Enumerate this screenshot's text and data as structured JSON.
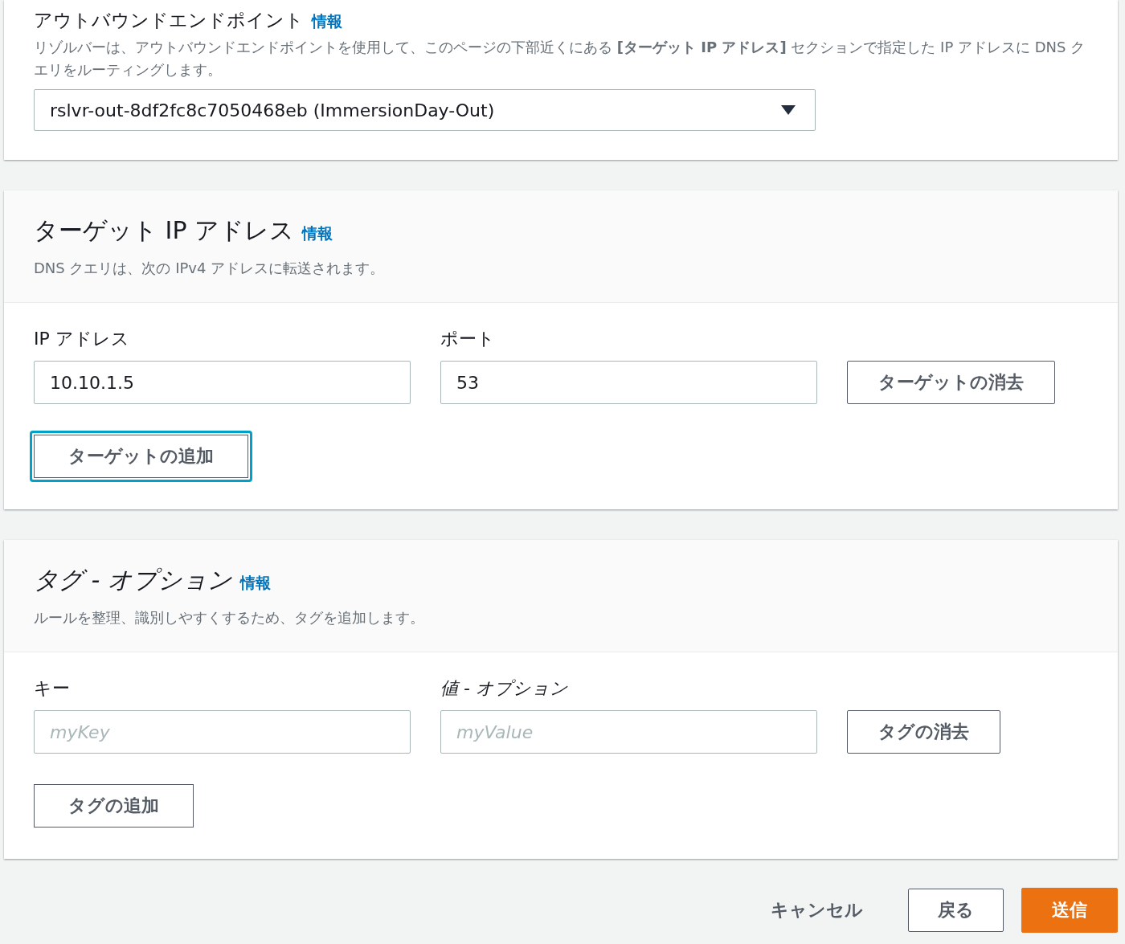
{
  "outbound_endpoint": {
    "title": "アウトバウンドエンドポイント",
    "info_link": "情報",
    "description": "リゾルバーは、アウトバウンドエンドポイントを使用して、このページの下部近くにある **[ターゲット IP アドレス]** セクションで指定した IP アドレスに DNS クエリをルーティングします。",
    "select_value": "rslvr-out-8df2fc8c7050468eb (ImmersionDay-Out)"
  },
  "target_ips": {
    "title": "ターゲット IP アドレス",
    "info_link": "情報",
    "description": "DNS クエリは、次の IPv4 アドレスに転送されます。",
    "fields": [
      {
        "label": "IP アドレス",
        "value": "10.10.1.5"
      },
      {
        "label": "ポート",
        "value": "53"
      }
    ],
    "remove_button": "ターゲットの消去",
    "add_button": {
      "label": "ターゲットの追加",
      "focused": true
    }
  },
  "tags": {
    "title": "タグ - オプション",
    "info_link": "情報",
    "description": "ルールを整理、識別しやすくするため、タグを追加します。",
    "fields": [
      {
        "label": "キー",
        "placeholder": "myKey"
      },
      {
        "label": "値 - オプション",
        "placeholder": "myValue"
      }
    ],
    "remove_button": "タグの消去",
    "add_button": {
      "label": "タグの追加",
      "focused": false
    }
  },
  "footer": {
    "cancel": "キャンセル",
    "back": "戻る",
    "submit": "送信"
  }
}
